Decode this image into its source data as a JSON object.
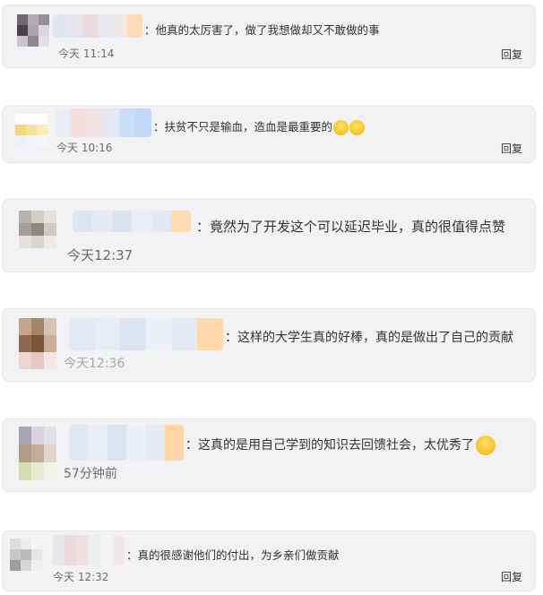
{
  "comments": [
    {
      "text": "：他真的太厉害了，做了我想做却又不敢做的事",
      "time": "今天 11:14",
      "reply": "回复",
      "avatar": [
        "#6e6a70",
        "#b0aab2",
        "#9a8f99",
        "#4c4148",
        "#a8a3ad",
        "#d9d6dc",
        "#c9c5cc",
        "#8b8690",
        "#e2e0e4"
      ],
      "name_colors": [
        "#dfe6f2",
        "#e9e3ec",
        "#ecd9dc",
        "#e6e8ef",
        "#f0e7e7",
        "#ffd9b3"
      ]
    },
    {
      "text": "：扶贫不只是输血，造血是最重要的",
      "emoji_tail": "😱😱",
      "time": "今天 10:16",
      "reply": "回复",
      "avatar": [
        "#ffffff",
        "#ffffff",
        "#ffffff",
        "#f2d87c",
        "#f5e39a",
        "#f9ecb8",
        "#e9f0f6",
        "#eef3f8",
        "#f4f7fa"
      ],
      "name_colors": [
        "#e7ecf5",
        "#f4dcdc",
        "#f1e2e6",
        "#e2e9f4",
        "#c6dcf8",
        "#bcd7f6"
      ]
    },
    {
      "text": "：竟然为了开发这个可以延迟毕业，真的很值得点赞",
      "time": "今天12:37",
      "reply": "",
      "avatar": [
        "#b9b2ab",
        "#d2ccc6",
        "#e5e1dd",
        "#a59d97",
        "#8f8681",
        "#cfc9c4",
        "#e4e0dc",
        "#d9d4d0",
        "#ece9e6"
      ],
      "name_colors": [
        "#dbe4f4",
        "#e5e9f4",
        "#d8e2f2",
        "#e9edf6",
        "#e1e7f3",
        "#ffd8ae"
      ]
    },
    {
      "text": "：这样的大学生真的好棒，真的是做出了自己的贡献",
      "time": "今天12:36",
      "reply": "",
      "avatar": [
        "#c2a58d",
        "#a88467",
        "#d7c3b4",
        "#8f6a4f",
        "#7a5439",
        "#c8ad99",
        "#e9d8cf",
        "#e6c7c4",
        "#f2e7e4"
      ],
      "name_colors": [
        "#e1e8f5",
        "#e6ebf5",
        "#dbe4f3",
        "#eceff6",
        "#e4e9f4",
        "#ffd6a8"
      ]
    },
    {
      "text": "：这真的是用自己学到的知识去回馈社会，太优秀了",
      "emoji_tail": "😊",
      "time": "57分钟前",
      "reply": "",
      "avatar": [
        "#a8a3b5",
        "#d8d3dc",
        "#e3dfe6",
        "#b49b85",
        "#c2ae9a",
        "#e0d4c8",
        "#d7dcb1",
        "#e6ead0",
        "#f1f3e4"
      ],
      "name_colors": [
        "#dfe7f5",
        "#e7ecf6",
        "#dbe3f3",
        "#eceff6",
        "#e6e9f2",
        "#ffd3a3"
      ]
    },
    {
      "text": "：真的很感谢他们的付出，为乡亲们做贡献",
      "time": "今天 12:32",
      "reply": "回复",
      "avatar": [
        "#dcdcdc",
        "#ececec",
        "#f4f4f4",
        "#c8c8c8",
        "#b9b9b9",
        "#e4e4e4",
        "#9e9e9e",
        "#d6d6d6",
        "#efefef"
      ],
      "name_colors": [
        "#e4e6ea",
        "#ecd9db",
        "#f1dfe1",
        "#eceef2",
        "#f2f2f5",
        "#f0e8e8"
      ]
    }
  ]
}
